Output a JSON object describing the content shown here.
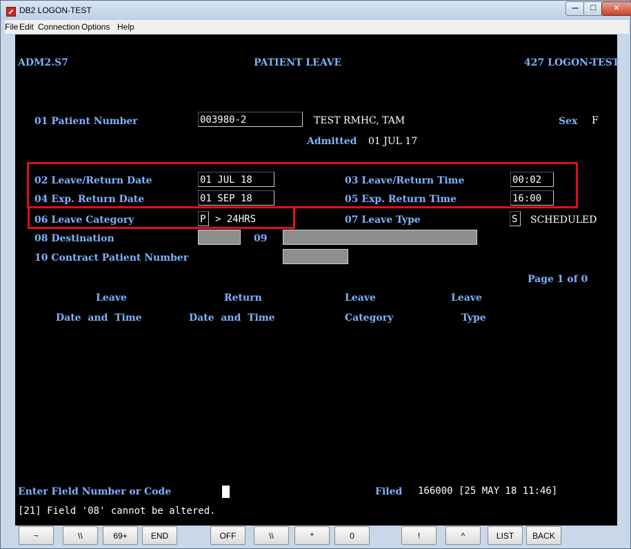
{
  "window": {
    "title": "DB2 LOGON-TEST"
  },
  "menu": [
    "File",
    "Edit",
    "Connection",
    "Options",
    "Help"
  ],
  "header": {
    "left": "ADM2.S7",
    "center": "PATIENT LEAVE",
    "right": "427 LOGON-TEST"
  },
  "patient": {
    "number_label": "01 Patient Number",
    "number_value": "003980-2",
    "name": "TEST RMHC, TAM",
    "sex_label": "Sex",
    "sex_value": "F",
    "admitted_label": "Admitted",
    "admitted_value": "01 JUL 17"
  },
  "fields": {
    "f02_label": "02 Leave/Return Date",
    "f02_value": "01 JUL 18",
    "f03_label": "03 Leave/Return Time",
    "f03_value": "00:02",
    "f04_label": "04 Exp. Return Date",
    "f04_value": "01 SEP 18",
    "f05_label": "05 Exp. Return Time",
    "f05_value": "16:00",
    "f06_label": "06 Leave Category",
    "f06_value": "P",
    "f06_desc": "> 24HRS",
    "f07_label": "07 Leave Type",
    "f07_value": "S",
    "f07_desc": "SCHEDULED",
    "f08_label": "08 Destination",
    "f09_label": "09",
    "f10_label": "10 Contract Patient Number"
  },
  "paging": "Page 1 of 0",
  "table_headers": {
    "leave": "Leave",
    "date_and_time_1": "Date  and  Time",
    "return": "Return",
    "date_and_time_2": "Date  and  Time",
    "leave_cat": "Leave",
    "category": "Category",
    "leave_type": "Leave",
    "type": "Type"
  },
  "footer": {
    "prompt": "Enter Field Number or Code",
    "filed_label": "Filed",
    "filed_value": "166000 [25 MAY 18 11:46]",
    "message": "[21] Field '08' cannot be altered."
  },
  "function_keys": [
    "~",
    "\\\\",
    "69+",
    "END",
    "OFF",
    "\\\\",
    "*",
    "0",
    "!",
    "^",
    "LIST",
    "BACK"
  ],
  "colors": {
    "terminal_bg": "#000000",
    "label_blue": "#7fb2ff",
    "highlight_red": "#e0101a"
  }
}
